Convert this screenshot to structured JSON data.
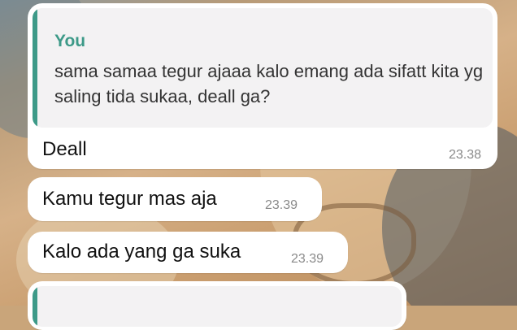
{
  "chat": {
    "messages": [
      {
        "reply_to": {
          "author": "You",
          "text": "sama samaa tegur ajaaa kalo emang ada sifatt kita yg saling tida sukaa, deall ga?"
        },
        "text": "Deall",
        "time": "23.38"
      },
      {
        "text": "Kamu tegur mas aja",
        "time": "23.39"
      },
      {
        "text": "Kalo ada yang ga suka",
        "time": "23.39"
      }
    ]
  },
  "colors": {
    "quote_accent": "#3d9a88",
    "bubble": "#ffffff",
    "quote_background": "#f3f2f3"
  }
}
